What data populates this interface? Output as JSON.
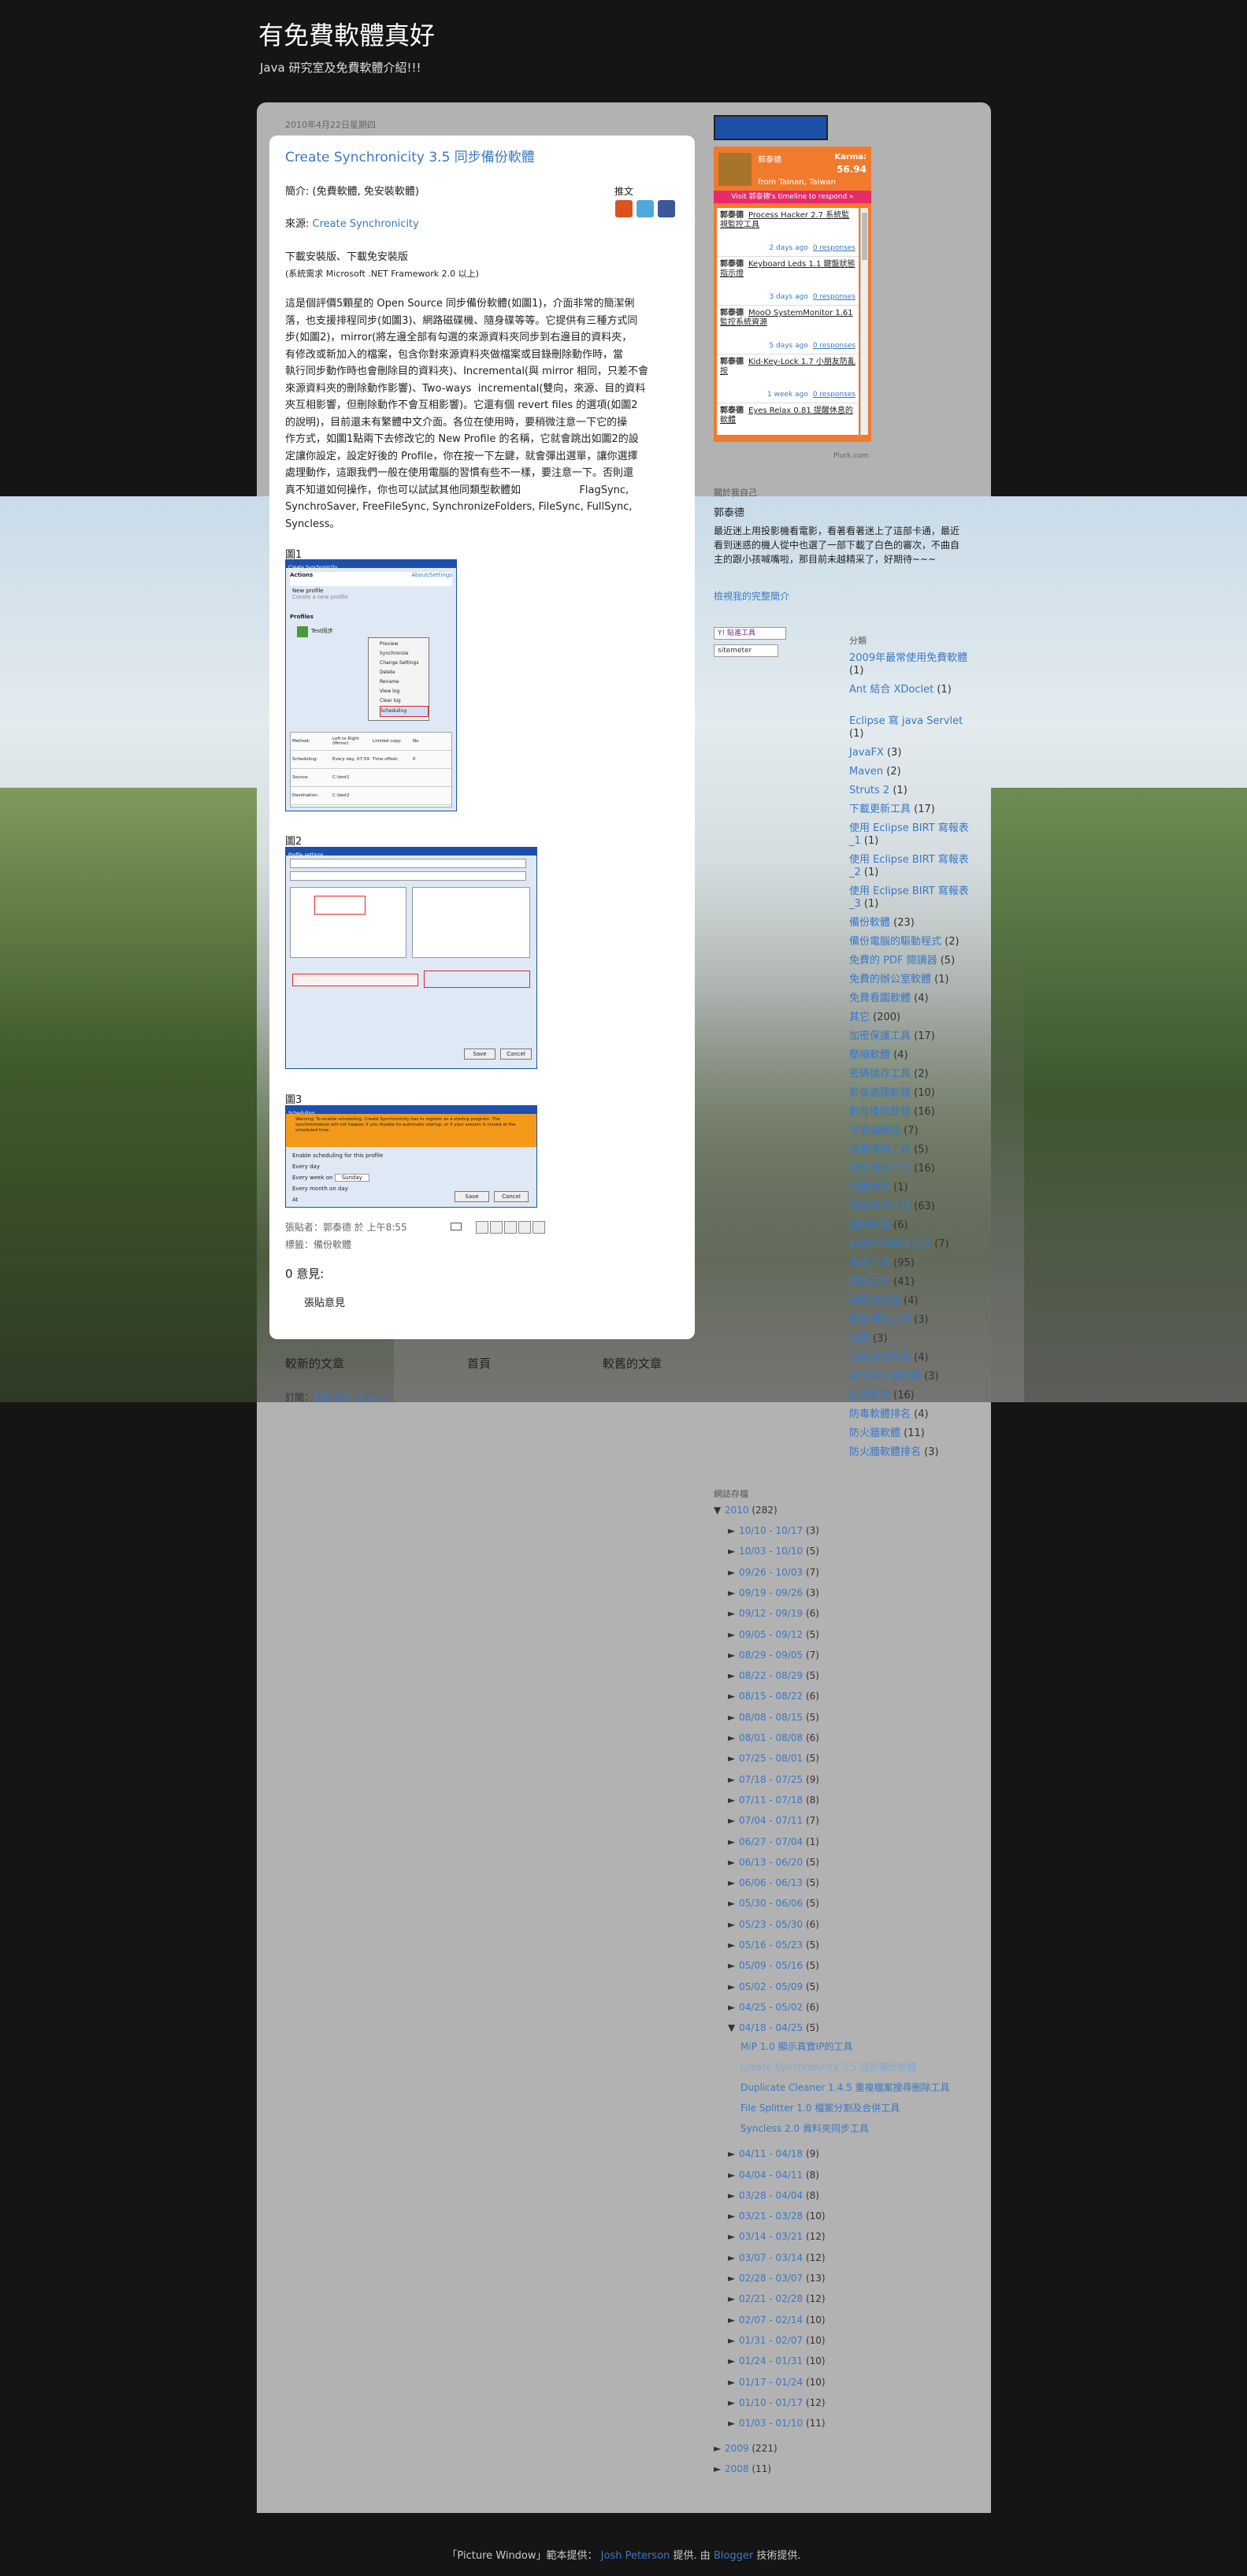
{
  "header": {
    "title": "有免費軟體真好",
    "description": "Java 研究室及免費軟體介紹!!!"
  },
  "post": {
    "date": "2010年4月22日星期四",
    "title": "Create Synchronicity 3.5 同步備份軟體",
    "intro_label": "簡介: (免費軟體, 免安裝軟體)",
    "source_label": "來源:",
    "source_link": "Create Synchronicity",
    "download_links": "下載安裝版、下載免安裝版",
    "requirement": "(系統需求 Microsoft .NET Framework 2.0 以上)",
    "share_label": "推文",
    "body_lines": [
      "這是個評價5顆星的 Open Source 同步備份軟體(如圖1)，介面非常的簡潔俐",
      "落，也支援排程同步(如圖3)、網路磁碟機、隨身碟等等。它提供有三種方式同",
      "步(如圖2)，mirror(將左邊全部有勾選的來源資料夾同步到右邊目的資料夾，",
      "有修改或新加入的檔案，包含你對來源資料夾做檔案或目錄刪除動作時，當",
      "執行同步動作時也會刪除目的資料夾)、Incremental(與 mirror 相同，只差不會",
      "來源資料夾的刪除動作影響)、Two-ways  incremental(雙向，來源、目的資料",
      "夾互相影響，但刪除動作不會互相影響)。它還有個 revert files 的選項(如圖2",
      "的說明)，目前還未有繁體中文介面。各位在使用時，要稍微注意一下它的操",
      "作方式，如圖1點兩下去修改它的 New Profile 的名稱，它就會跳出如圖2的設",
      "定讓你設定，設定好後的 Profile，你在按一下左鍵，就會彈出選單，讓你選擇",
      "處理動作，這跟我們一般在使用電腦的習慣有些不一樣，要注意一下。否則還",
      "真不知道如何操作，你也可以試試其他同類型軟體如                  FlagSync,",
      "SynchroSaver, FreeFileSync, SynchronizeFolders, FileSync, FullSync,",
      "Syncless。"
    ],
    "figures": [
      "圖1",
      "圖2",
      "圖3"
    ],
    "fig1": {
      "title": "Create Synchronicity",
      "link": "About/Settings",
      "section_actions": "Actions",
      "new_profile": "New profile",
      "new_profile_sub": "Create a new profile",
      "section_profiles": "Profiles",
      "profile_name": "Test同步",
      "menu": [
        "Preview",
        "Synchronize",
        "Change Settings",
        "Delete",
        "Rename",
        "View log",
        "Clear log",
        "Scheduling"
      ],
      "details": [
        [
          "Method:",
          "Left to Right (Mirror)",
          "Limited copy:",
          "No"
        ],
        [
          "Scheduling:",
          "Every day, 07:59",
          "Time offset:",
          "0"
        ],
        [
          "Source:",
          "C:\\test1",
          "",
          ""
        ],
        [
          "Destination:",
          "C:\\test2",
          "",
          ""
        ]
      ]
    },
    "fig2": {
      "title": "Profile settings",
      "buttons": [
        "Save",
        "Cancel"
      ]
    },
    "fig3": {
      "title": "Scheduling",
      "warning": "Warning: To enable scheduling, Create Synchronicity has to register as a startup program. The synchronization will not happen if you disable its automatic startup, or if your session is closed at the scheduled time.",
      "check": "Enable scheduling for this profile",
      "options": [
        "Every day",
        "Every week on",
        "Every month on day"
      ],
      "week_value": "Sunday",
      "at_label": "At",
      "buttons": [
        "Save",
        "Cancel"
      ]
    },
    "posted_by": "張貼者：郭泰德 於 上午8:55",
    "labels": "標籤：備份軟體",
    "comments": "0 意見:",
    "post_comment": "張貼意見"
  },
  "nav": {
    "newer": "較新的文章",
    "home": "首頁",
    "older": "較舊的文章",
    "subscribe_label": "訂閱：",
    "subscribe_link": "張貼意見 (Atom)"
  },
  "plurk": {
    "user": "郭泰德",
    "karma_label": "Karma:",
    "karma": "56.94",
    "from": "from Tainan, Taiwan",
    "timeline_link": "Visit 郭泰德's timeline to respond »",
    "entries": [
      {
        "user": "郭泰德",
        "text": "Process Hacker 2.7 系統監視監控工具",
        "time": "2 days ago",
        "resp": "0 responses"
      },
      {
        "user": "郭泰德",
        "text": "Keyboard Leds 1.1 鍵盤狀態指示燈",
        "time": "3 days ago",
        "resp": "0 responses"
      },
      {
        "user": "郭泰德",
        "text": "MooO SystemMonitor 1.61 監控系統資源",
        "time": "5 days ago",
        "resp": "0 responses"
      },
      {
        "user": "郭泰德",
        "text": "Kid-Key-Lock 1.7 小朋友防亂按",
        "time": "1 week ago",
        "resp": "0 responses"
      },
      {
        "user": "郭泰德",
        "text": "Eyes Relax 0.81 提醒休息的軟體",
        "time": "",
        "resp": ""
      }
    ],
    "footer": "Plurk.com"
  },
  "about": {
    "heading": "關於我自己",
    "name": "郭泰德",
    "bio": "最近迷上用投影機看電影，看著看著迷上了這部卡通，最近看到迷惑的機人從中也選了一部下載了白色的審次，不曲自主的跟小孩喊嘴啦，那目前未越精采了，好期待~~~",
    "profile_link": "檢視我的完整簡介",
    "badge1": "Y! 貼進工具",
    "badge2": "sitemeter"
  },
  "labels": {
    "heading": "分類",
    "items": [
      {
        "name": "2009年最常使用免費軟體",
        "count": "(1)"
      },
      {
        "name": "Ant 結合 XDoclet",
        "count": "(1)"
      },
      {
        "name": "Eclipse 寫 java Servlet",
        "count": "(1)"
      },
      {
        "name": "JavaFX",
        "count": "(3)"
      },
      {
        "name": "Maven",
        "count": "(2)"
      },
      {
        "name": "Struts 2",
        "count": "(1)"
      },
      {
        "name": "下載更新工具",
        "count": "(17)"
      },
      {
        "name": "使用 Eclipse BIRT 寫報表_1",
        "count": "(1)"
      },
      {
        "name": "使用 Eclipse BIRT 寫報表_2",
        "count": "(1)"
      },
      {
        "name": "使用 Eclipse BIRT 寫報表_3",
        "count": "(1)"
      },
      {
        "name": "備份軟體",
        "count": "(23)"
      },
      {
        "name": "備份電腦的驅動程式",
        "count": "(2)"
      },
      {
        "name": "免費的 PDF 閱讀器",
        "count": "(5)"
      },
      {
        "name": "免費的辦公室軟體",
        "count": "(1)"
      },
      {
        "name": "免費看圖軟體",
        "count": "(4)"
      },
      {
        "name": "其它",
        "count": "(200)"
      },
      {
        "name": "加密保護工具",
        "count": "(17)"
      },
      {
        "name": "壓縮軟體",
        "count": "(4)"
      },
      {
        "name": "密碼儲存工具",
        "count": "(2)"
      },
      {
        "name": "影像處理軟體",
        "count": "(10)"
      },
      {
        "name": "影音播放軟體",
        "count": "(16)"
      },
      {
        "name": "文書編輯器",
        "count": "(7)"
      },
      {
        "name": "檔案傳輸工具",
        "count": "(5)"
      },
      {
        "name": "檔案搜尋工具",
        "count": "(16)"
      },
      {
        "name": "檔案總管",
        "count": "(1)"
      },
      {
        "name": "檔案處理工具",
        "count": "(63)"
      },
      {
        "name": "燒錄軟體",
        "count": "(6)"
      },
      {
        "name": "目錄空間檢查工具",
        "count": "(7)"
      },
      {
        "name": "系統工具",
        "count": "(95)"
      },
      {
        "name": "網路工具",
        "count": "(41)"
      },
      {
        "name": "網路瀏覽器",
        "count": "(4)"
      },
      {
        "name": "螢幕擷取工具",
        "count": "(3)"
      },
      {
        "name": "遊戲",
        "count": "(3)"
      },
      {
        "name": "遠端遙控軟體",
        "count": "(4)"
      },
      {
        "name": "郵件客戶端軟體",
        "count": "(3)"
      },
      {
        "name": "防毒軟體",
        "count": "(16)"
      },
      {
        "name": "防毒軟體排名",
        "count": "(4)"
      },
      {
        "name": "防火牆軟體",
        "count": "(11)"
      },
      {
        "name": "防火牆軟體排名",
        "count": "(3)"
      }
    ]
  },
  "archive": {
    "heading": "網誌存檔",
    "year2010": "2010",
    "year2010_count": "(282)",
    "weeks_a": [
      [
        "10/10 - 10/17",
        "(3)"
      ],
      [
        "10/03 - 10/10",
        "(5)"
      ],
      [
        "09/26 - 10/03",
        "(7)"
      ],
      [
        "09/19 - 09/26",
        "(3)"
      ],
      [
        "09/12 - 09/19",
        "(6)"
      ],
      [
        "09/05 - 09/12",
        "(5)"
      ],
      [
        "08/29 - 09/05",
        "(7)"
      ],
      [
        "08/22 - 08/29",
        "(5)"
      ],
      [
        "08/15 - 08/22",
        "(6)"
      ],
      [
        "08/08 - 08/15",
        "(5)"
      ],
      [
        "08/01 - 08/08",
        "(6)"
      ],
      [
        "07/25 - 08/01",
        "(5)"
      ],
      [
        "07/18 - 07/25",
        "(9)"
      ],
      [
        "07/11 - 07/18",
        "(8)"
      ],
      [
        "07/04 - 07/11",
        "(7)"
      ],
      [
        "06/27 - 07/04",
        "(1)"
      ],
      [
        "06/13 - 06/20",
        "(5)"
      ],
      [
        "06/06 - 06/13",
        "(5)"
      ],
      [
        "05/30 - 06/06",
        "(5)"
      ],
      [
        "05/23 - 05/30",
        "(6)"
      ],
      [
        "05/16 - 05/23",
        "(5)"
      ],
      [
        "05/09 - 05/16",
        "(5)"
      ],
      [
        "05/02 - 05/09",
        "(5)"
      ],
      [
        "04/25 - 05/02",
        "(6)"
      ]
    ],
    "open_week": [
      "04/18 - 04/25",
      "(5)"
    ],
    "open_posts": [
      "MiP 1.0 顯示真實IP的工具",
      "Create Synchronicity 3.5 同步備份軟體",
      "Duplicate Cleaner 1.4.5 重複檔案搜尋刪除工具",
      "File Splitter 1.0 檔案分割及合併工具",
      "Syncless 2.0 資料夾同步工具"
    ],
    "weeks_b": [
      [
        "04/11 - 04/18",
        "(9)"
      ],
      [
        "04/04 - 04/11",
        "(8)"
      ],
      [
        "03/28 - 04/04",
        "(8)"
      ],
      [
        "03/21 - 03/28",
        "(10)"
      ],
      [
        "03/14 - 03/21",
        "(12)"
      ],
      [
        "03/07 - 03/14",
        "(12)"
      ],
      [
        "02/28 - 03/07",
        "(13)"
      ],
      [
        "02/21 - 02/28",
        "(12)"
      ],
      [
        "02/07 - 02/14",
        "(10)"
      ],
      [
        "01/31 - 02/07",
        "(10)"
      ],
      [
        "01/24 - 01/31",
        "(10)"
      ],
      [
        "01/17 - 01/24",
        "(10)"
      ],
      [
        "01/10 - 01/17",
        "(12)"
      ],
      [
        "01/03 - 01/10",
        "(11)"
      ]
    ],
    "year2009": "2009",
    "year2009_count": "(221)",
    "year2008": "2008",
    "year2008_count": "(11)"
  },
  "footer": {
    "pre": "「Picture Window」範本提供：",
    "author": "Josh Peterson",
    "mid": "提供. 由",
    "blogger": "Blogger",
    "post": "技術提供."
  }
}
